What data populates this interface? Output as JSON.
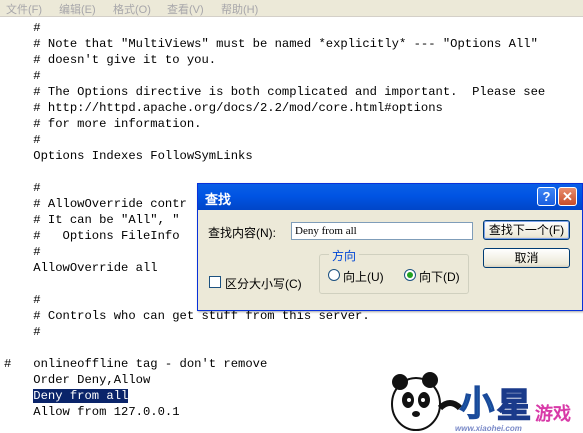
{
  "menubar": {
    "items": [
      "文件(F)",
      "编辑(E)",
      "格式(O)",
      "查看(V)",
      "帮助(H)"
    ]
  },
  "editor": {
    "lines": [
      "    #",
      "    # Note that \"MultiViews\" must be named *explicitly* --- \"Options All\"",
      "    # doesn't give it to you.",
      "    #",
      "    # The Options directive is both complicated and important.  Please see",
      "    # http://httpd.apache.org/docs/2.2/mod/core.html#options",
      "    # for more information.",
      "    #",
      "    Options Indexes FollowSymLinks",
      "",
      "    #",
      "    # AllowOverride contr",
      "    # It can be \"All\", \"",
      "    #   Options FileInfo",
      "    #",
      "    AllowOverride all",
      "",
      "    #",
      "    # Controls who can get stuff from this server.",
      "    #",
      "",
      "#   onlineoffline tag - don't remove",
      "    Order Deny,Allow",
      "Deny from all",
      "    Allow from 127.0.0.1"
    ],
    "selected_text": "Deny from all"
  },
  "find_dialog": {
    "title": "查找",
    "find_label": "查找内容(N):",
    "find_value": "Deny from all",
    "find_next_label": "查找下一个(F)",
    "cancel_label": "取消",
    "match_case_label": "区分大小写(C)",
    "match_case_checked": false,
    "direction_label": "方向",
    "up_label": "向上(U)",
    "down_label": "向下(D)",
    "selected_direction": "down"
  },
  "watermark": {
    "logo_text": "小星游戏",
    "url": "www.xiaohei.com"
  },
  "colors": {
    "selection": "#0a246a",
    "titlebar": "#0054e3",
    "dialog_bg": "#ece9d8"
  }
}
